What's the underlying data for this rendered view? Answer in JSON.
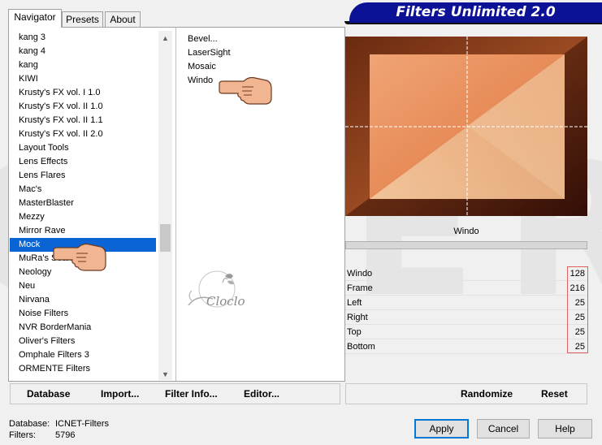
{
  "tabs": [
    {
      "label": "Navigator",
      "active": true
    },
    {
      "label": "Presets",
      "active": false
    },
    {
      "label": "About",
      "active": false
    }
  ],
  "banner_title": "Filters Unlimited 2.0",
  "category_list": [
    "kang 3",
    "kang 4",
    "kang",
    "KIWI",
    "Krusty's FX vol. I 1.0",
    "Krusty's FX vol. II 1.0",
    "Krusty's FX vol. II 1.1",
    "Krusty's FX vol. II 2.0",
    "Layout Tools",
    "Lens Effects",
    "Lens Flares",
    "Mac's",
    "MasterBlaster",
    "Mezzy",
    "Mirror Rave",
    "Mock",
    "MuRa's Seamless",
    "Neology",
    "Neu",
    "Nirvana",
    "Noise Filters",
    "NVR BorderMania",
    "Oliver's Filters",
    "Omphale Filters 3",
    "ORMENTE Filters"
  ],
  "selected_category": "Mock",
  "filter_list": [
    "Bevel...",
    "LaserSight",
    "Mosaic",
    "Windo"
  ],
  "watermark_text": "Cloclo",
  "preview_title": "Windo",
  "params": [
    {
      "name": "Windo",
      "value": "128"
    },
    {
      "name": "Frame",
      "value": "216"
    },
    {
      "name": "Left",
      "value": "25"
    },
    {
      "name": "Right",
      "value": "25"
    },
    {
      "name": "Top",
      "value": "25"
    },
    {
      "name": "Bottom",
      "value": "25"
    }
  ],
  "toolbar": {
    "database": "Database",
    "import": "Import...",
    "filter_info": "Filter Info...",
    "editor": "Editor...",
    "randomize": "Randomize",
    "reset": "Reset"
  },
  "status": {
    "database_label": "Database:",
    "database_value": "ICNET-Filters",
    "filters_label": "Filters:",
    "filters_value": "5796"
  },
  "buttons": {
    "apply": "Apply",
    "cancel": "Cancel",
    "help": "Help"
  },
  "colors": {
    "banner": "#0c1296",
    "selection": "#0a64d4",
    "highlight_box": "#e06060"
  }
}
